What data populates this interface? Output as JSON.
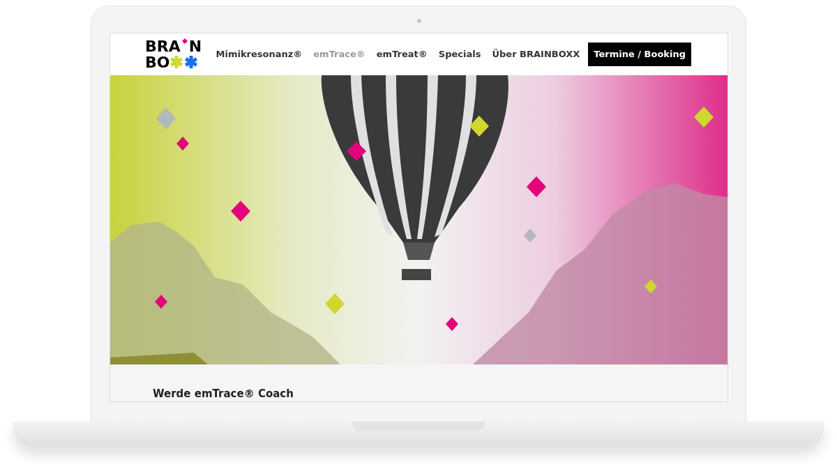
{
  "logo": {
    "line_1": [
      "BRA",
      "N"
    ],
    "line_2": "BO"
  },
  "nav": [
    {
      "label": "Mimikresonanz®",
      "selected": false
    },
    {
      "label": "emTrace®",
      "selected": true
    },
    {
      "label": "emTreat®",
      "selected": false
    },
    {
      "label": "Specials",
      "selected": false
    },
    {
      "label": "Über BRAINBOXX",
      "selected": false
    }
  ],
  "cta_button": "Termine / Booking",
  "heading": "Werde emTrace® Coach"
}
